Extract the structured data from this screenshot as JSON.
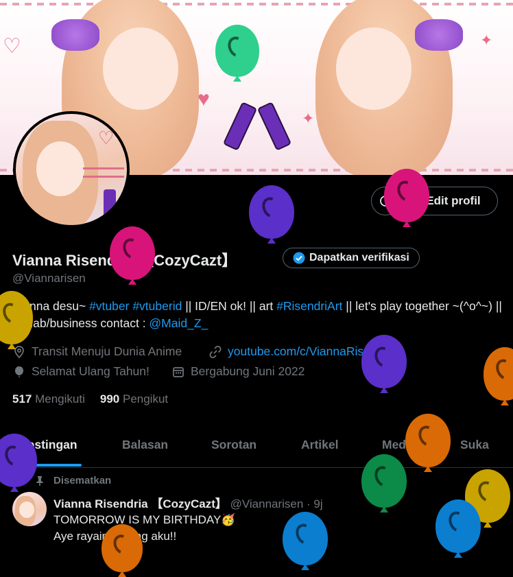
{
  "profile": {
    "name": "Vianna Risendria 【CozyCazt】",
    "handle": "@Viannarisen",
    "verify_label": "Dapatkan verifikasi",
    "edit_label": "Edit profil",
    "bio_parts": {
      "p1": "Vianna desu~ ",
      "tag1": "#vtuber",
      "sp1": " ",
      "tag2": "#vtuberid",
      "p2": " || ID/EN ok! || art ",
      "tag3": "#RisendriArt",
      "p3": " || let's play together ~(^o^~) || Collab/business contact : ",
      "mention": "@Maid_Z_"
    },
    "location": "Transit Menuju Dunia Anime",
    "website": "youtube.com/c/ViannaRisend...",
    "birthday": "Selamat Ulang Tahun!",
    "joined": "Bergabung Juni 2022",
    "following_count": "517",
    "following_label": "Mengikuti",
    "followers_count": "990",
    "followers_label": "Pengikut"
  },
  "tabs": [
    "Postingan",
    "Balasan",
    "Sorotan",
    "Artikel",
    "Media",
    "Suka"
  ],
  "pinned_label": "Disematkan",
  "tweet": {
    "author": "Vianna Risendria 【CozyCazt】",
    "handle_time": "@Viannarisen · 9j",
    "line1": "TOMORROW IS MY BIRTHDAY🥳",
    "line2": "Aye rayain bareng aku!!",
    "more": "···"
  },
  "colors": {
    "accent": "#1d9bf0",
    "verified": "#1d9bf0",
    "balloon_purple": "#5b2fc9",
    "balloon_pink": "#d8147a",
    "balloon_gold": "#c9a400",
    "balloon_orange": "#d96a06",
    "balloon_green": "#0c8a47",
    "balloon_blue": "#0b7ed0"
  }
}
